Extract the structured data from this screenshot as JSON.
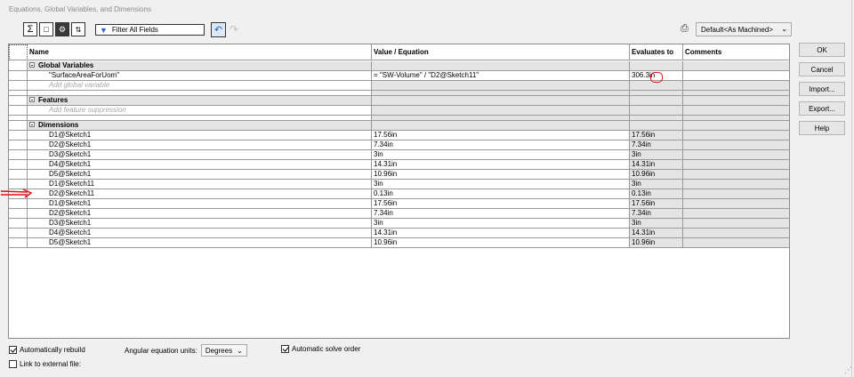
{
  "window": {
    "title": "Equations, Global Variables, and Dimensions"
  },
  "toolbar": {
    "icons": [
      "sigma-icon",
      "global-view-icon",
      "filter-view-icon",
      "sort-icon"
    ],
    "filter_label": "Filter All Fields",
    "config_select": "Default<As Machined>"
  },
  "columns": [
    "Name",
    "Value / Equation",
    "Evaluates to",
    "Comments"
  ],
  "sections": {
    "global": {
      "title": "Global Variables",
      "add": "Add global variable"
    },
    "features": {
      "title": "Features",
      "add": "Add feature suppression"
    },
    "dimensions": {
      "title": "Dimensions"
    }
  },
  "global_rows": [
    {
      "name": "\"SurfaceAreaForUom\"",
      "value": "= \"SW-Volume\" / \"D2@Sketch11\"",
      "evaluates": "306.3",
      "unit": "in",
      "comments": ""
    }
  ],
  "dim_rows": [
    {
      "name": "D1@Sketch1",
      "value": "17.56in",
      "evaluates": "17.56in"
    },
    {
      "name": "D2@Sketch1",
      "value": "7.34in",
      "evaluates": "7.34in"
    },
    {
      "name": "D3@Sketch1",
      "value": "3in",
      "evaluates": "3in"
    },
    {
      "name": "D4@Sketch1",
      "value": "14.31in",
      "evaluates": "14.31in"
    },
    {
      "name": "D5@Sketch1",
      "value": "10.96in",
      "evaluates": "10.96in"
    },
    {
      "name": "D1@Sketch11",
      "value": "3in",
      "evaluates": "3in"
    },
    {
      "name": "D2@Sketch11",
      "value": "0.13in",
      "evaluates": "0.13in"
    },
    {
      "name": "D1@Sketch1",
      "value": "17.56in",
      "evaluates": "17.56in"
    },
    {
      "name": "D2@Sketch1",
      "value": "7.34in",
      "evaluates": "7.34in"
    },
    {
      "name": "D3@Sketch1",
      "value": "3in",
      "evaluates": "3in"
    },
    {
      "name": "D4@Sketch1",
      "value": "14.31in",
      "evaluates": "14.31in"
    },
    {
      "name": "D5@Sketch1",
      "value": "10.96in",
      "evaluates": "10.96in"
    }
  ],
  "buttons": {
    "ok": "OK",
    "cancel": "Cancel",
    "import": "Import...",
    "export": "Export...",
    "help": "Help"
  },
  "bottom": {
    "auto_rebuild": "Automatically rebuild",
    "angular_units_label": "Angular equation units:",
    "angular_units_value": "Degrees",
    "auto_solve": "Automatic solve order",
    "link_external": "Link to external file:"
  },
  "colors": {
    "annotation": "#e01010",
    "accent": "#2d5fd0",
    "row_shade": "#e4e4e4"
  }
}
